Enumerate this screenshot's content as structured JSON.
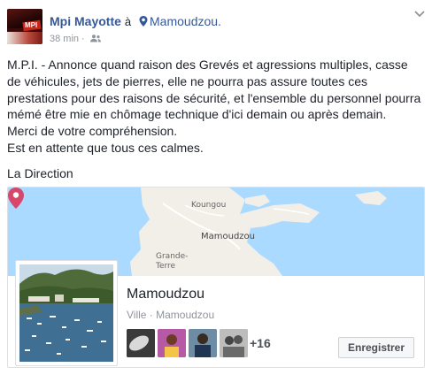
{
  "post": {
    "page_name": "Mpi Mayotte",
    "at_word": "à",
    "place": "Mamoudzou.",
    "time_ago": "38 min",
    "separator": "·",
    "paragraphs": [
      "M.P.I. - Annonce quand raison des Grevés et agressions multiples, casse de véhicules, jets de pierres, elle ne pourra pas assure toutes ces prestations pour des raisons de sécurité, et l'ensemble du personnel pourra mémé être mie en chômage technique d'ici demain ou après demain.\nMerci de votre compréhension.\nEst en attente que tous ces calmes."
    ],
    "signature": "La Direction"
  },
  "avatar": {
    "text": "MPI"
  },
  "map": {
    "labels": [
      "Koungou",
      "Mamoudzou",
      "Grande-\nTerre"
    ],
    "pin_color": "#d6476a",
    "water_color": "#aadaff",
    "land_color": "#f2efe9"
  },
  "place_card": {
    "title": "Mamoudzou",
    "subtitle": "Ville · Mamoudzou",
    "more_visitors": "+16",
    "save_label": "Enregistrer"
  },
  "colors": {
    "link": "#365899",
    "meta": "#90949c"
  }
}
